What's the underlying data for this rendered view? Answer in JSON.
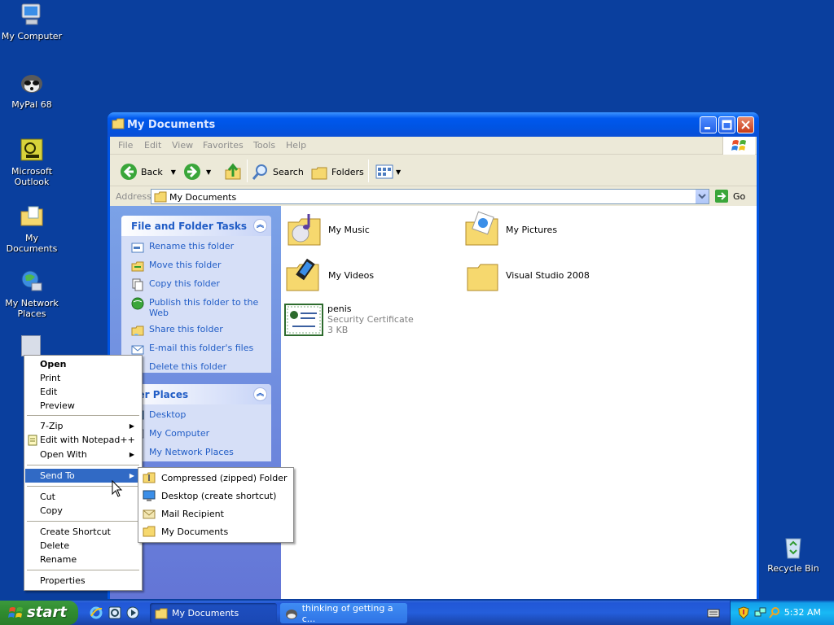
{
  "desktop": {
    "icons": [
      {
        "label": "My Computer",
        "icon": "computer-icon"
      },
      {
        "label": "MyPal 68",
        "icon": "raccoon-browser-icon"
      },
      {
        "label": "Microsoft Outlook",
        "icon": "outlook-icon"
      },
      {
        "label": "My Documents",
        "icon": "documents-folder-icon"
      },
      {
        "label": "My Network Places",
        "icon": "network-icon"
      },
      {
        "label": "Recycle Bin",
        "icon": "recycle-bin-icon"
      }
    ]
  },
  "window": {
    "title": "My Documents",
    "menu": [
      "File",
      "Edit",
      "View",
      "Favorites",
      "Tools",
      "Help"
    ],
    "toolbar": {
      "back": "Back",
      "search": "Search",
      "folders": "Folders"
    },
    "address": {
      "label": "Address",
      "value": "My Documents",
      "go": "Go"
    },
    "file_tasks": {
      "title": "File and Folder Tasks",
      "items": [
        "Rename this folder",
        "Move this folder",
        "Copy this folder",
        "Publish this folder to the Web",
        "Share this folder",
        "E-mail this folder's files",
        "Delete this folder"
      ]
    },
    "other_places": {
      "title": "her Places",
      "items": [
        "Desktop",
        "My Computer",
        "My Network Places"
      ]
    },
    "files": [
      {
        "name": "My Music",
        "icon": "music-folder-icon"
      },
      {
        "name": "My Pictures",
        "icon": "pictures-folder-icon"
      },
      {
        "name": "My Videos",
        "icon": "videos-folder-icon"
      },
      {
        "name": "Visual Studio 2008",
        "icon": "folder-icon"
      },
      {
        "name": "penis",
        "type": "Security Certificate",
        "size": "3 KB",
        "icon": "certificate-icon"
      }
    ]
  },
  "context_menu": {
    "items": [
      "Open",
      "Print",
      "Edit",
      "Preview",
      "7-Zip",
      "Edit with Notepad++",
      "Open With",
      "Send To",
      "Cut",
      "Copy",
      "Create Shortcut",
      "Delete",
      "Rename",
      "Properties"
    ],
    "highlighted": "Send To"
  },
  "send_to_menu": {
    "items": [
      "Compressed (zipped) Folder",
      "Desktop (create shortcut)",
      "Mail Recipient",
      "My Documents"
    ]
  },
  "taskbar": {
    "start": "start",
    "tasks": [
      "My Documents",
      "thinking of getting a c..."
    ],
    "clock": "5:32 AM"
  }
}
